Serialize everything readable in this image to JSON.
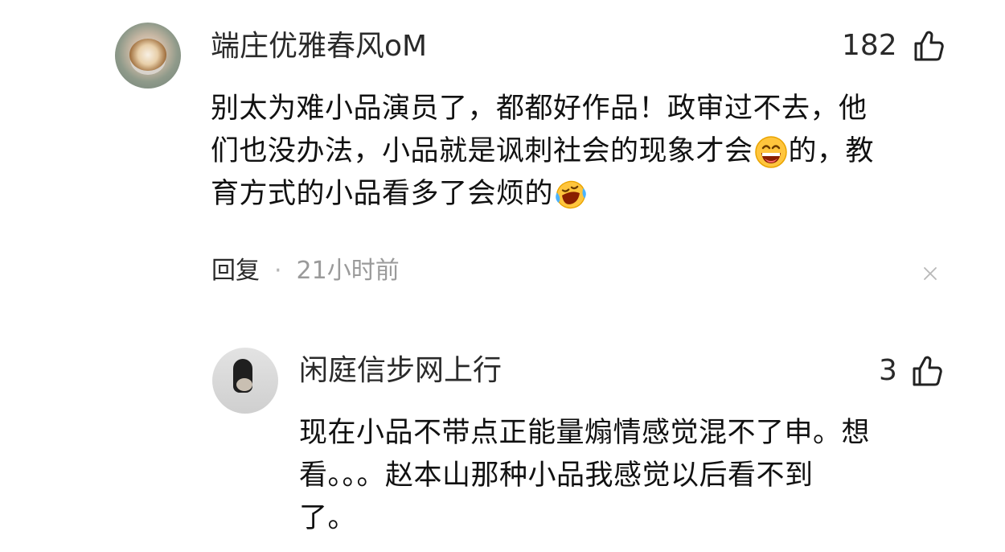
{
  "comment": {
    "username": "端庄优雅春风oM",
    "likes": "182",
    "line1": "别太为难小品演员了，都都好作品！政审过不去，他",
    "line2_a": "们也没办法，小品就是讽刺社会的现象才会",
    "line2_b": "的，教",
    "line3": "育方式的小品看多了会烦的",
    "emoji1": "grinning-face-emoji",
    "emoji2": "crying-laughing-face-emoji",
    "reply_label": "回复",
    "separator": "·",
    "time": "21小时前"
  },
  "reply": {
    "username": "闲庭信步网上行",
    "likes": "3",
    "line1": "现在小品不带点正能量煽情感觉混不了申。想",
    "line2": "看。。。赵本山那种小品我感觉以后看不到",
    "line3": "了。"
  }
}
